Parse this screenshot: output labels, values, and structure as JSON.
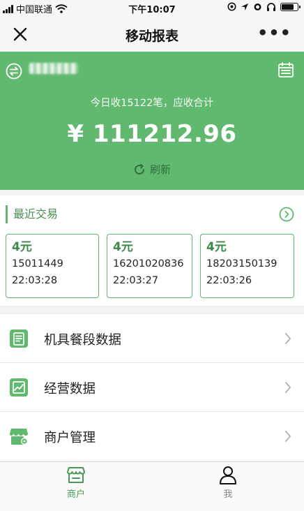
{
  "status_bar": {
    "carrier": "中国联通",
    "time": "下午10:07"
  },
  "nav": {
    "title": "移动报表",
    "more": "•••"
  },
  "hero": {
    "summary": "今日收15122笔，应收合计",
    "amount": "¥ 111212.96",
    "refresh_label": "刷新"
  },
  "recent": {
    "title": "最近交易",
    "transactions": [
      {
        "amount": "4元",
        "id": "15011449",
        "time": "22:03:28"
      },
      {
        "amount": "4元",
        "id": "16201020836",
        "time": "22:03:27"
      },
      {
        "amount": "4元",
        "id": "18203150139",
        "time": "22:03:26"
      }
    ]
  },
  "menu": {
    "items": [
      {
        "label": "机具餐段数据",
        "icon": "receipt-icon"
      },
      {
        "label": "经营数据",
        "icon": "trend-chart-icon"
      },
      {
        "label": "商户管理",
        "icon": "store-settings-icon"
      }
    ]
  },
  "tabbar": {
    "tabs": [
      {
        "label": "商户",
        "icon": "store-icon",
        "active": true
      },
      {
        "label": "我",
        "icon": "person-icon",
        "active": false
      }
    ]
  },
  "colors": {
    "brand_green": "#60b96e",
    "dark_green": "#3e8a4b",
    "text_dark": "#222222",
    "tab_inactive": "#888888"
  }
}
